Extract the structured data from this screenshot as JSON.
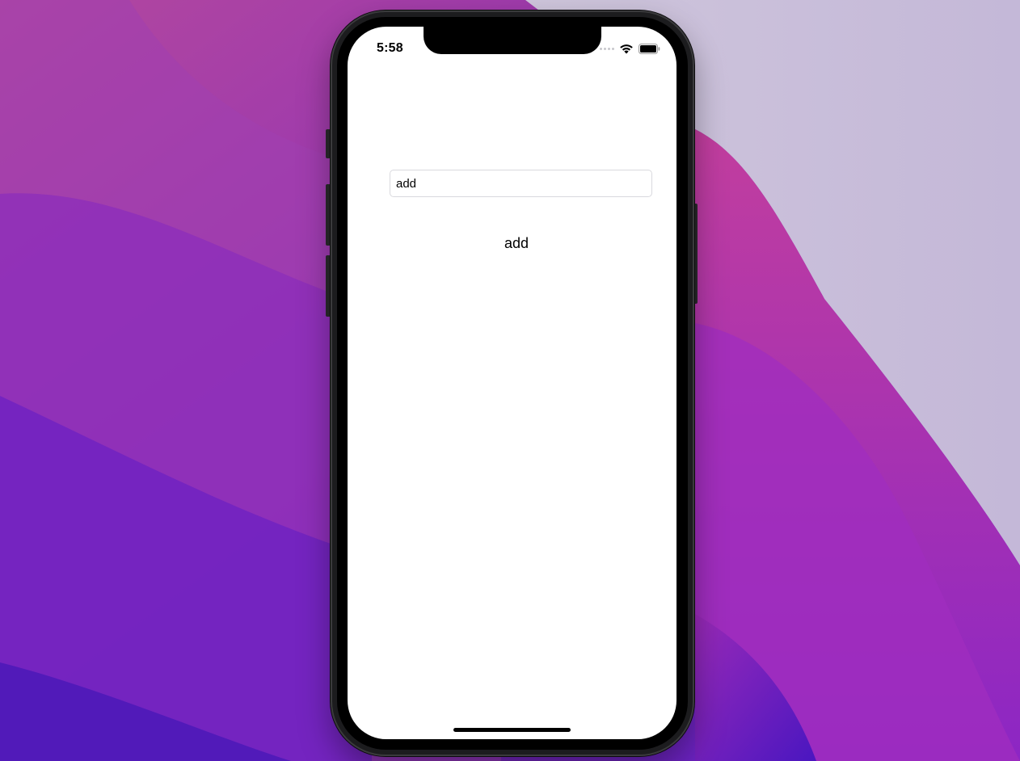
{
  "status_bar": {
    "time": "5:58",
    "icons": [
      "signal-icon",
      "wifi-icon",
      "battery-icon"
    ]
  },
  "form": {
    "input_value": "add",
    "label": "add"
  },
  "colors": {
    "wallpaper_accent": "#7a2bb8",
    "screen_background": "#ffffff",
    "field_border": "#d9d9de"
  }
}
